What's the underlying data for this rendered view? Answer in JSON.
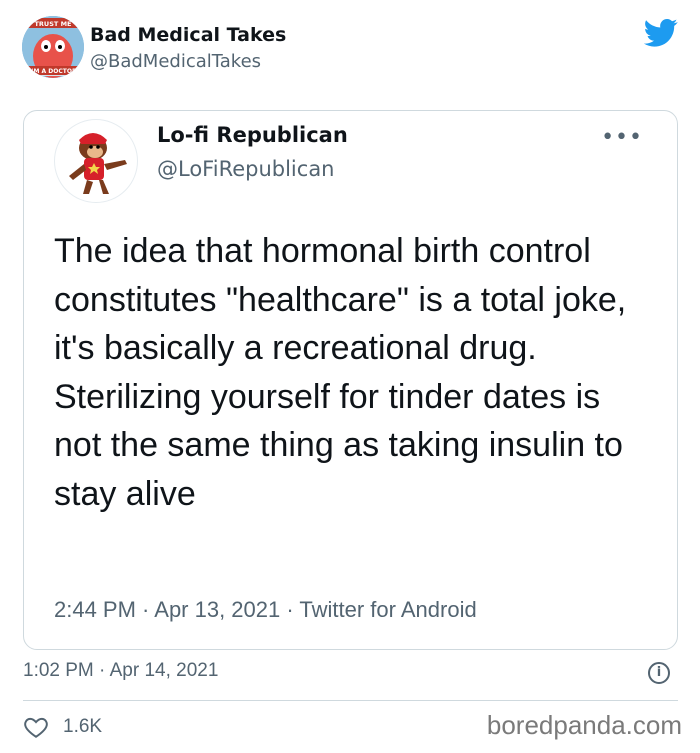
{
  "outer_tweet": {
    "name": "Bad Medical Takes",
    "handle": "@BadMedicalTakes",
    "avatar_text_top": "TRUST ME",
    "avatar_text_bottom": "I'M A DOCTOR",
    "timestamp": "1:02 PM · Apr 14, 2021",
    "likes": "1.6K"
  },
  "quoted_tweet": {
    "name": "Lo-fi Republican",
    "handle": "@LoFiRepublican",
    "more_label": "•••",
    "text": "The idea that hormonal birth control constitutes \"healthcare\" is a total joke, it's basically a recreational drug. Sterilizing yourself for tinder dates is not the same thing as taking insulin to stay alive",
    "meta": "2:44 PM · Apr 13, 2021 · Twitter for Android"
  },
  "icons": {
    "brand": "twitter-bird-icon",
    "info": "info-icon",
    "like": "heart-icon"
  },
  "info_glyph": "i",
  "watermark": "boredpanda.com",
  "colors": {
    "twitter_blue": "#1d9bf0",
    "secondary_text": "#536471",
    "border": "#cfd9de"
  }
}
